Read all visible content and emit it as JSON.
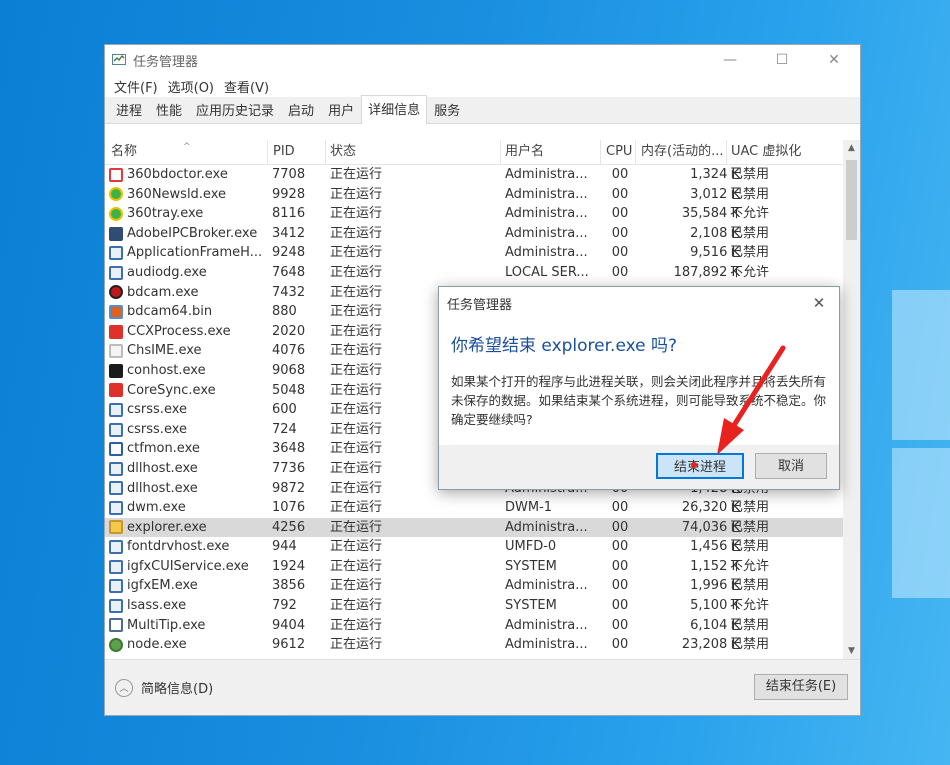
{
  "window": {
    "title": "任务管理器",
    "controls": [
      "—",
      "☐",
      "✕"
    ]
  },
  "menu": [
    "文件(F)",
    "选项(O)",
    "查看(V)"
  ],
  "tabs": [
    {
      "label": "进程",
      "active": false
    },
    {
      "label": "性能",
      "active": false
    },
    {
      "label": "应用历史记录",
      "active": false
    },
    {
      "label": "启动",
      "active": false
    },
    {
      "label": "用户",
      "active": false
    },
    {
      "label": "详细信息",
      "active": true
    },
    {
      "label": "服务",
      "active": false
    }
  ],
  "columns": {
    "name": "名称",
    "pid": "PID",
    "status": "状态",
    "user": "用户名",
    "cpu": "CPU",
    "mem": "内存(活动的...",
    "uac": "UAC 虚拟化"
  },
  "processes": [
    {
      "name": "360bdoctor.exe",
      "pid": "7708",
      "status": "正在运行",
      "user": "Administra...",
      "cpu": "00",
      "mem": "1,324 K",
      "uac": "已禁用",
      "icon": "doctor-icon",
      "color": "#ffffff",
      "border": "#e03a3a"
    },
    {
      "name": "360Newsld.exe",
      "pid": "9928",
      "status": "正在运行",
      "user": "Administra...",
      "cpu": "00",
      "mem": "3,012 K",
      "uac": "已禁用",
      "icon": "360-icon",
      "color": "#3cb34a",
      "border": "#f0c000"
    },
    {
      "name": "360tray.exe",
      "pid": "8116",
      "status": "正在运行",
      "user": "Administra...",
      "cpu": "00",
      "mem": "35,584 K",
      "uac": "不允许",
      "icon": "360-icon",
      "color": "#3cb34a",
      "border": "#f0c000"
    },
    {
      "name": "AdobeIPCBroker.exe",
      "pid": "3412",
      "status": "正在运行",
      "user": "Administra...",
      "cpu": "00",
      "mem": "2,108 K",
      "uac": "已禁用",
      "icon": "window-icon",
      "color": "#2f4d74",
      "border": "#2f4d74"
    },
    {
      "name": "ApplicationFrameH...",
      "pid": "9248",
      "status": "正在运行",
      "user": "Administra...",
      "cpu": "00",
      "mem": "9,516 K",
      "uac": "已禁用",
      "icon": "app-frame-icon",
      "color": "#e8f0f8",
      "border": "#3d6fb0"
    },
    {
      "name": "audiodg.exe",
      "pid": "7648",
      "status": "正在运行",
      "user": "LOCAL SER...",
      "cpu": "00",
      "mem": "187,892 K",
      "uac": "不允许",
      "icon": "app-frame-icon",
      "color": "#e8f0f8",
      "border": "#3d6fb0"
    },
    {
      "name": "bdcam.exe",
      "pid": "7432",
      "status": "正在运行",
      "user": "",
      "cpu": "",
      "mem": "",
      "uac": "",
      "icon": "record-icon",
      "color": "#c01818",
      "border": "#222222"
    },
    {
      "name": "bdcam64.bin",
      "pid": "880",
      "status": "正在运行",
      "user": "",
      "cpu": "",
      "mem": "",
      "uac": "",
      "icon": "puzzle-icon",
      "color": "#e06020",
      "border": "#4a8fd8"
    },
    {
      "name": "CCXProcess.exe",
      "pid": "2020",
      "status": "正在运行",
      "user": "",
      "cpu": "",
      "mem": "",
      "uac": "",
      "icon": "creative-cloud-icon",
      "color": "#e0302a",
      "border": "#e0302a"
    },
    {
      "name": "ChsIME.exe",
      "pid": "4076",
      "status": "正在运行",
      "user": "",
      "cpu": "",
      "mem": "",
      "uac": "",
      "icon": "ime-icon",
      "color": "#f4f4f4",
      "border": "#bbbbbb"
    },
    {
      "name": "conhost.exe",
      "pid": "9068",
      "status": "正在运行",
      "user": "",
      "cpu": "",
      "mem": "",
      "uac": "",
      "icon": "console-icon",
      "color": "#1b1b1b",
      "border": "#1b1b1b"
    },
    {
      "name": "CoreSync.exe",
      "pid": "5048",
      "status": "正在运行",
      "user": "",
      "cpu": "",
      "mem": "",
      "uac": "",
      "icon": "creative-cloud-icon",
      "color": "#e0302a",
      "border": "#e0302a"
    },
    {
      "name": "csrss.exe",
      "pid": "600",
      "status": "正在运行",
      "user": "",
      "cpu": "",
      "mem": "",
      "uac": "",
      "icon": "app-frame-icon",
      "color": "#e8f0f8",
      "border": "#3d6fb0"
    },
    {
      "name": "csrss.exe",
      "pid": "724",
      "status": "正在运行",
      "user": "",
      "cpu": "",
      "mem": "",
      "uac": "",
      "icon": "app-frame-icon",
      "color": "#e8f0f8",
      "border": "#3d6fb0"
    },
    {
      "name": "ctfmon.exe",
      "pid": "3648",
      "status": "正在运行",
      "user": "",
      "cpu": "",
      "mem": "",
      "uac": "",
      "icon": "pen-icon",
      "color": "#ffffff",
      "border": "#2a5fa8"
    },
    {
      "name": "dllhost.exe",
      "pid": "7736",
      "status": "正在运行",
      "user": "",
      "cpu": "",
      "mem": "",
      "uac": "",
      "icon": "app-frame-icon",
      "color": "#e8f0f8",
      "border": "#3d6fb0"
    },
    {
      "name": "dllhost.exe",
      "pid": "9872",
      "status": "正在运行",
      "user": "Administra...",
      "cpu": "00",
      "mem": "1,428 K",
      "uac": "已禁用",
      "icon": "app-frame-icon",
      "color": "#e8f0f8",
      "border": "#3d6fb0"
    },
    {
      "name": "dwm.exe",
      "pid": "1076",
      "status": "正在运行",
      "user": "DWM-1",
      "cpu": "00",
      "mem": "26,320 K",
      "uac": "已禁用",
      "icon": "app-frame-icon",
      "color": "#e8f0f8",
      "border": "#3d6fb0"
    },
    {
      "name": "explorer.exe",
      "pid": "4256",
      "status": "正在运行",
      "user": "Administra...",
      "cpu": "00",
      "mem": "74,036 K",
      "uac": "已禁用",
      "icon": "folder-icon",
      "color": "#f3c84b",
      "border": "#c9962a",
      "selected": true
    },
    {
      "name": "fontdrvhost.exe",
      "pid": "944",
      "status": "正在运行",
      "user": "UMFD-0",
      "cpu": "00",
      "mem": "1,456 K",
      "uac": "已禁用",
      "icon": "app-frame-icon",
      "color": "#e8f0f8",
      "border": "#3d6fb0"
    },
    {
      "name": "igfxCUIService.exe",
      "pid": "1924",
      "status": "正在运行",
      "user": "SYSTEM",
      "cpu": "00",
      "mem": "1,152 K",
      "uac": "不允许",
      "icon": "app-frame-icon",
      "color": "#e8f0f8",
      "border": "#3d6fb0"
    },
    {
      "name": "igfxEM.exe",
      "pid": "3856",
      "status": "正在运行",
      "user": "Administra...",
      "cpu": "00",
      "mem": "1,996 K",
      "uac": "已禁用",
      "icon": "app-frame-icon",
      "color": "#e8f0f8",
      "border": "#3d6fb0"
    },
    {
      "name": "lsass.exe",
      "pid": "792",
      "status": "正在运行",
      "user": "SYSTEM",
      "cpu": "00",
      "mem": "5,100 K",
      "uac": "不允许",
      "icon": "app-frame-icon",
      "color": "#e8f0f8",
      "border": "#3d6fb0"
    },
    {
      "name": "MultiTip.exe",
      "pid": "9404",
      "status": "正在运行",
      "user": "Administra...",
      "cpu": "00",
      "mem": "6,104 K",
      "uac": "已禁用",
      "icon": "blank-window-icon",
      "color": "#ffffff",
      "border": "#4a6c94"
    },
    {
      "name": "node.exe",
      "pid": "9612",
      "status": "正在运行",
      "user": "Administra...",
      "cpu": "00",
      "mem": "23,208 K",
      "uac": "已禁用",
      "icon": "node-icon",
      "color": "#5fa04e",
      "border": "#3d7a30"
    }
  ],
  "footer": {
    "fewer_details": "简略信息(D)",
    "end_task": "结束任务(E)"
  },
  "dialog": {
    "title": "任务管理器",
    "close": "✕",
    "heading": "你希望结束 explorer.exe 吗?",
    "body": "如果某个打开的程序与此进程关联，则会关闭此程序并且将丢失所有未保存的数据。如果结束某个系统进程，则可能导致系统不稳定。你确定要继续吗?",
    "end_process_label": "结束进程",
    "cancel_label": "取消"
  },
  "colors": {
    "accent": "#0078d7",
    "annotation_arrow": "#e8221f"
  }
}
